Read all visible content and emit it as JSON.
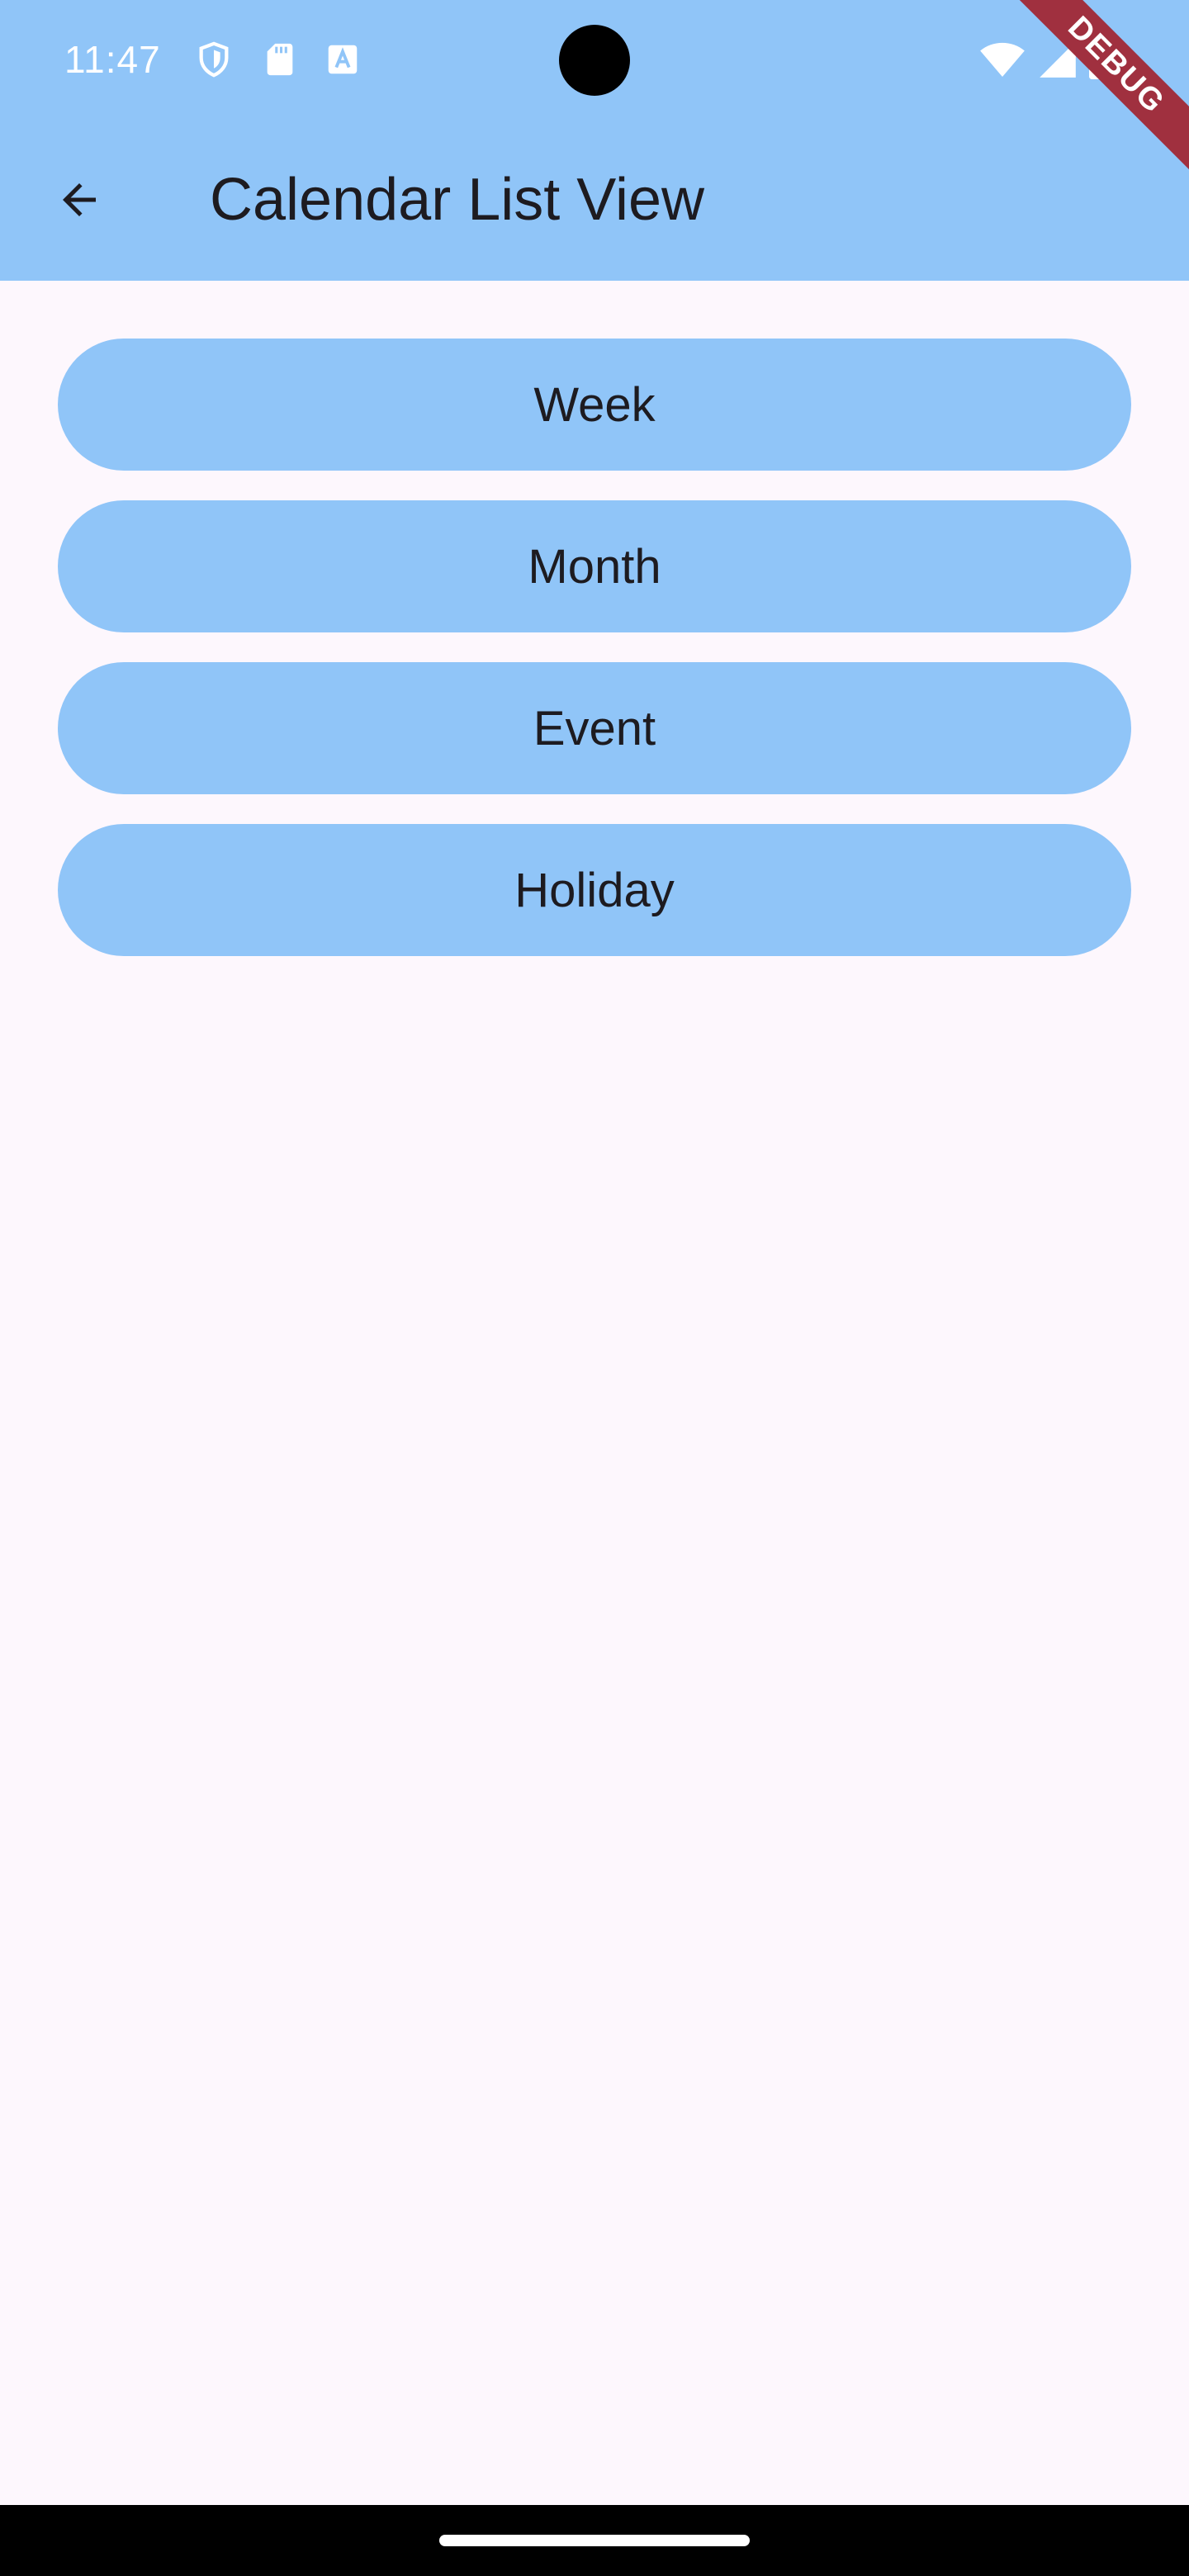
{
  "status_bar": {
    "time": "11:47",
    "icons_left": [
      "shield-icon",
      "sd-card-icon",
      "keyboard-a-icon"
    ],
    "icons_right": [
      "wifi-icon",
      "cell-signal-icon",
      "battery-icon"
    ]
  },
  "app_bar": {
    "title": "Calendar List View",
    "back_icon": "arrow-back-icon"
  },
  "debug_banner": {
    "label": "DEBUG"
  },
  "buttons": [
    {
      "label": "Week"
    },
    {
      "label": "Month"
    },
    {
      "label": "Event"
    },
    {
      "label": "Holiday"
    }
  ],
  "colors": {
    "app_bar": "#90C5F8",
    "button": "#90C5F8",
    "background": "#FDF7FD",
    "text": "#1D1B20",
    "debug_ribbon": "#A0303F"
  }
}
